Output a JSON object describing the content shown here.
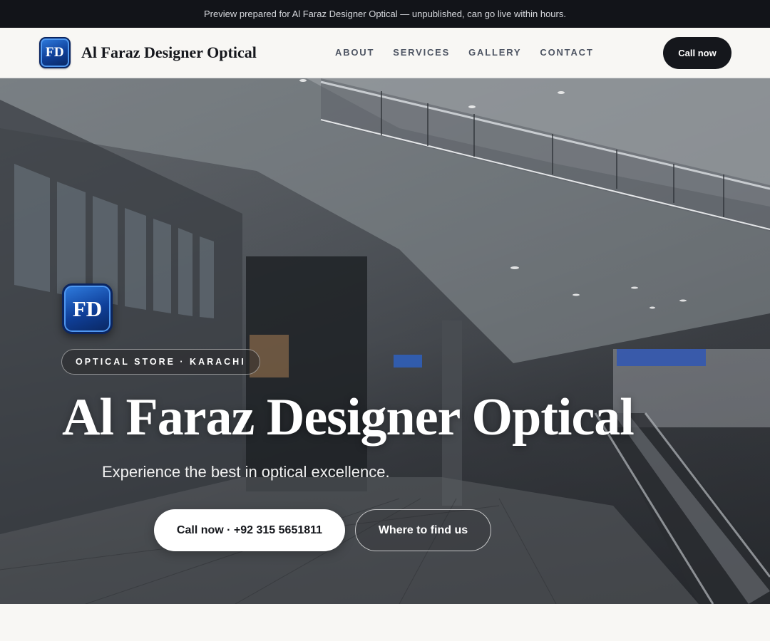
{
  "preview_bar": {
    "text": "Preview prepared for Al Faraz Designer Optical — unpublished, can go live within hours."
  },
  "header": {
    "logo_text": "FD",
    "brand_name": "Al Faraz Designer Optical",
    "nav": [
      {
        "label": "ABOUT"
      },
      {
        "label": "SERVICES"
      },
      {
        "label": "GALLERY"
      },
      {
        "label": "CONTACT"
      }
    ],
    "call_button": "Call now"
  },
  "hero": {
    "logo_text": "FD",
    "eyebrow": "OPTICAL STORE · KARACHI",
    "title": "Al Faraz Designer Optical",
    "tagline": "Experience the best in optical excellence.",
    "primary_cta": "Call now · +92 315 5651811",
    "secondary_cta": "Where to find us"
  },
  "colors": {
    "dark": "#15171c",
    "badge_blue": "#1d5bc4",
    "background": "#f8f7f4"
  }
}
